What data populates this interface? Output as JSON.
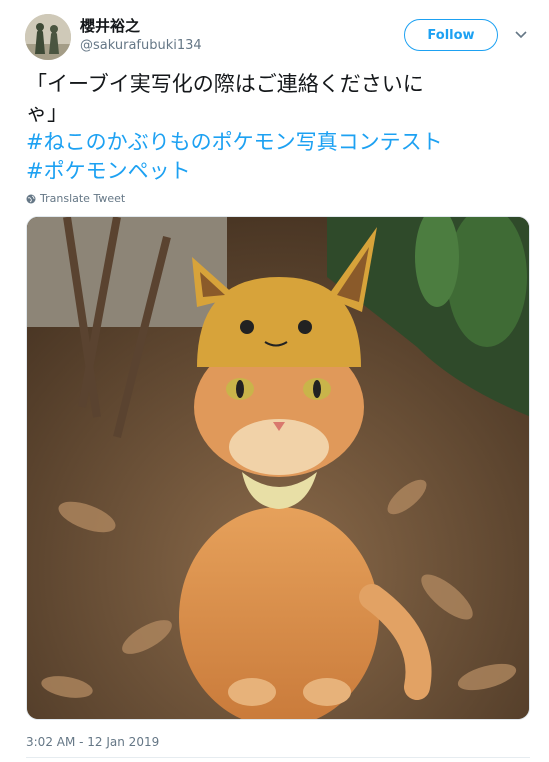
{
  "user": {
    "display_name": "櫻井裕之",
    "handle": "@sakurafubuki134"
  },
  "follow_label": "Follow",
  "tweet": {
    "text_lines": [
      "「イーブイ実写化の際はご連絡くださいに",
      "ゃ」"
    ],
    "hashtags": [
      "#ねこのかぶりものポケモン写真コンテスト",
      "#ポケモンペット"
    ]
  },
  "translate_label": "Translate Tweet",
  "timestamp": "3:02 AM - 12 Jan 2019",
  "icons": {
    "caret": "chevron-down-icon",
    "translate": "globe-icon"
  },
  "colors": {
    "accent": "#1da1f2",
    "secondary_text": "#657786"
  }
}
